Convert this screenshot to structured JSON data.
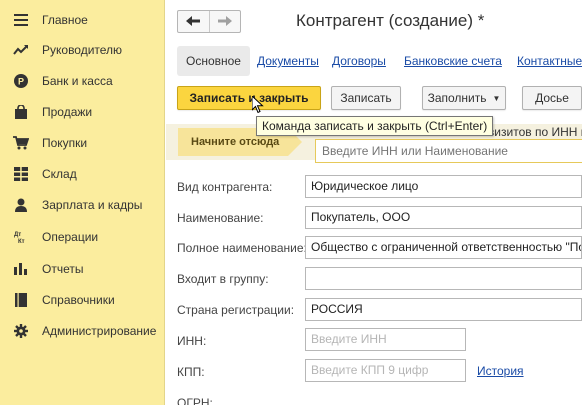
{
  "sidebar": {
    "items": [
      {
        "label": "Главное",
        "icon": "menu-lines-icon"
      },
      {
        "label": "Руководителю",
        "icon": "trend-line-icon"
      },
      {
        "label": "Банк и касса",
        "icon": "coin-icon"
      },
      {
        "label": "Продажи",
        "icon": "shopping-bag-icon"
      },
      {
        "label": "Покупки",
        "icon": "shopping-cart-icon"
      },
      {
        "label": "Склад",
        "icon": "warehouse-grid-icon"
      },
      {
        "label": "Зарплата и кадры",
        "icon": "person-icon"
      },
      {
        "label": "Операции",
        "icon": "debit-credit-icon"
      },
      {
        "label": "Отчеты",
        "icon": "bar-chart-icon"
      },
      {
        "label": "Справочники",
        "icon": "book-icon"
      },
      {
        "label": "Администрирование",
        "icon": "gear-icon"
      }
    ]
  },
  "header": {
    "title": "Контрагент (создание) *",
    "back_icon": "arrow-left-icon",
    "forward_icon": "arrow-right-icon"
  },
  "tabs": [
    {
      "label": "Основное",
      "active": true
    },
    {
      "label": "Документы"
    },
    {
      "label": "Договоры"
    },
    {
      "label": "Банковские счета"
    },
    {
      "label": "Контактные"
    }
  ],
  "toolbar": {
    "save_close": "Записать и закрыть",
    "save": "Записать",
    "fill": "Заполнить",
    "more": "Досье"
  },
  "tooltip": "Команда записать и закрыть (Ctrl+Enter)",
  "hint": {
    "start_here": "Начните отсюда",
    "right_text": "еквизитов по ИНН и",
    "search_placeholder": "Введите ИНН или Наименование"
  },
  "form": {
    "kind": {
      "label": "Вид контрагента:",
      "value": "Юридическое лицо"
    },
    "name": {
      "label": "Наименование:",
      "value": "Покупатель, ООО"
    },
    "full_name": {
      "label": "Полное наименование:",
      "value": "Общество с ограниченной ответственностью \"Поку"
    },
    "group": {
      "label": "Входит в группу:",
      "value": ""
    },
    "country": {
      "label": "Страна регистрации:",
      "value": "РОССИЯ"
    },
    "inn": {
      "label": "ИНН:",
      "placeholder": "Введите ИНН"
    },
    "kpp": {
      "label": "КПП:",
      "placeholder": "Введите КПП 9 цифр",
      "history": "История"
    },
    "ogrn": {
      "label": "ОГРН:"
    }
  },
  "colors": {
    "sidebar_bg": "#fbed9e",
    "primary_button": "#fbd53f",
    "link": "#1a4ba6"
  }
}
